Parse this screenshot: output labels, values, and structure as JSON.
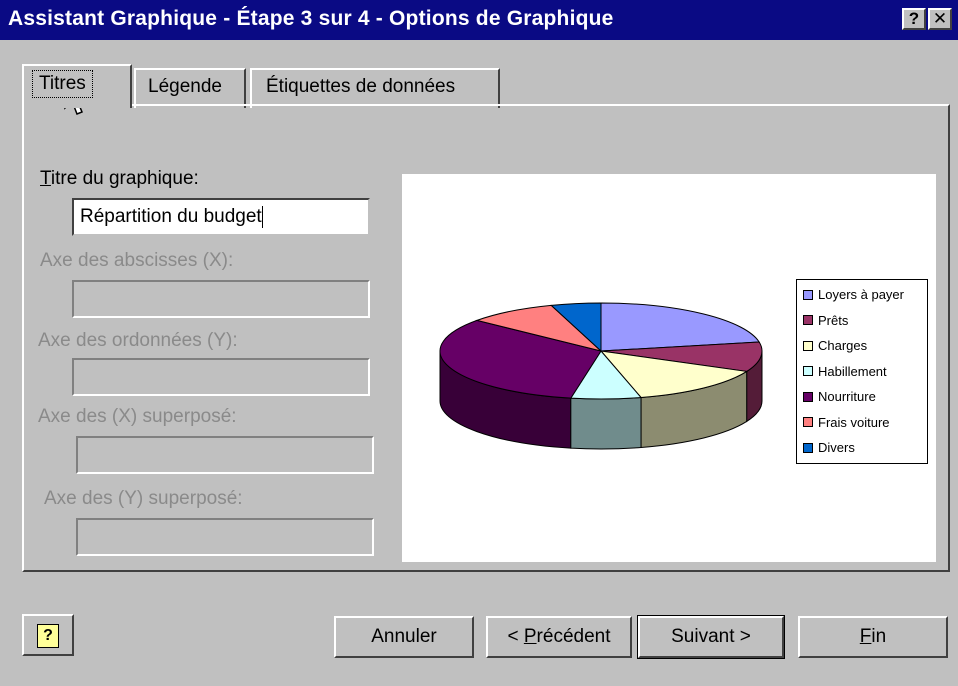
{
  "window": {
    "title": "Assistant Graphique - Étape 3 sur 4 - Options de Graphique",
    "help_glyph": "?",
    "close_glyph": "✕"
  },
  "tabs": [
    {
      "label": "Titres",
      "active": true
    },
    {
      "label": "Légende",
      "active": false
    },
    {
      "label": "Étiquettes de données",
      "active": false
    }
  ],
  "form": {
    "chart_title_label": "Titre du graphique:",
    "chart_title_value": "Répartition du budget",
    "x_axis_label": "Axe des abscisses (X):",
    "y_axis_label": "Axe des ordonnées (Y):",
    "x2_axis_label": "Axe des (X)  superposé:",
    "y2_axis_label": "Axe des (Y) superposé:"
  },
  "chart_data": {
    "type": "pie",
    "style": "3d-pie",
    "categories": [
      "Loyers à payer",
      "Prêts",
      "Charges",
      "Habillement",
      "Nourriture",
      "Frais voiture",
      "Divers"
    ],
    "values": [
      22,
      10,
      14,
      7,
      33,
      9,
      5
    ],
    "colors": [
      "#9999ff",
      "#993366",
      "#ffffcc",
      "#ccffff",
      "#660066",
      "#ff8080",
      "#0066cc"
    ],
    "legend_position": "right"
  },
  "buttons": {
    "help_glyph": "?",
    "cancel": "Annuler",
    "previous": "< Précédent",
    "next": "Suivant >",
    "finish": "Fin"
  },
  "colors": {
    "titlebar": "#0a0a84",
    "dialog": "#c0c0c0"
  }
}
